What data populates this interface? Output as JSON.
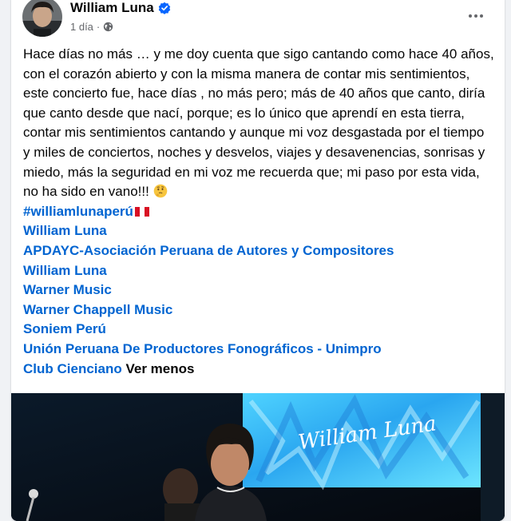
{
  "post": {
    "author": "William Luna",
    "time": "1 día",
    "dot": "·",
    "text": "Hace días no más … y me doy cuenta que sigo cantando como hace 40 años, con el corazón abierto y con la misma manera de contar mis sentimientos, este concierto fue, hace días , no más pero; más de 40 años que canto, diría que canto desde que nací, porque; es lo único que aprendí en esta tierra, contar mis sentimientos cantando y aunque mi voz desgastada por el tiempo y miles de conciertos, noches y desvelos, viajes y desavenencias, sonrisas y miedo, más la seguridad en mi voz me recuerda que; mi paso por esta vida, no ha sido en vano!!!",
    "hashtag": "#williamlunaperú",
    "tags": [
      "William Luna",
      "APDAYC-Asociación Peruana de Autores y Compositores",
      "William Luna",
      "Warner Music",
      "Warner Chappell Music",
      "Soniem Perú",
      "Unión Peruana De Productores Fonográficos - Unimpro"
    ],
    "last_tag": "Club Cienciano",
    "see_less": "Ver menos",
    "image_signature": "William Luna"
  },
  "colors": {
    "link": "#0064d1",
    "text": "#050505",
    "meta": "#65676b",
    "verified": "#0866ff",
    "background": "#f0f2f5"
  },
  "icons": [
    "verified-badge-icon",
    "globe-icon",
    "more-options-icon",
    "thinking-face-emoji",
    "peru-flag-icon"
  ]
}
